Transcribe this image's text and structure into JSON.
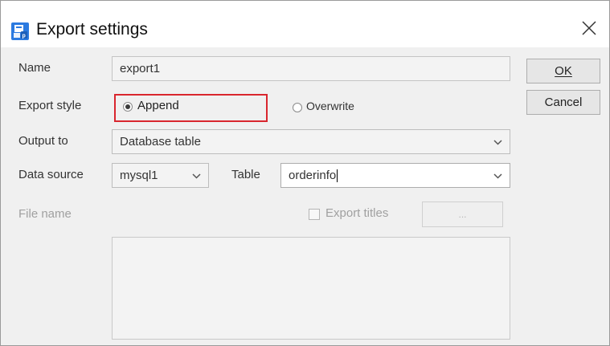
{
  "window": {
    "title": "Export settings",
    "icon": "export-settings-icon"
  },
  "form": {
    "name_label": "Name",
    "name_value": "export1",
    "export_style_label": "Export style",
    "export_style_options": [
      {
        "label": "Append",
        "selected": true
      },
      {
        "label": "Overwrite",
        "selected": false
      }
    ],
    "output_to_label": "Output to",
    "output_to_value": "Database table",
    "data_source_label": "Data source",
    "data_source_value": "mysql1",
    "table_label": "Table",
    "table_value": "orderinfo",
    "file_name_label": "File name",
    "export_titles_label": "Export titles",
    "export_titles_checked": false,
    "browse_label": "...",
    "file_text_value": ""
  },
  "buttons": {
    "ok_label": "OK",
    "cancel_label": "Cancel"
  },
  "colors": {
    "highlight": "#d9262e",
    "icon_blue": "#2b7ae0"
  }
}
